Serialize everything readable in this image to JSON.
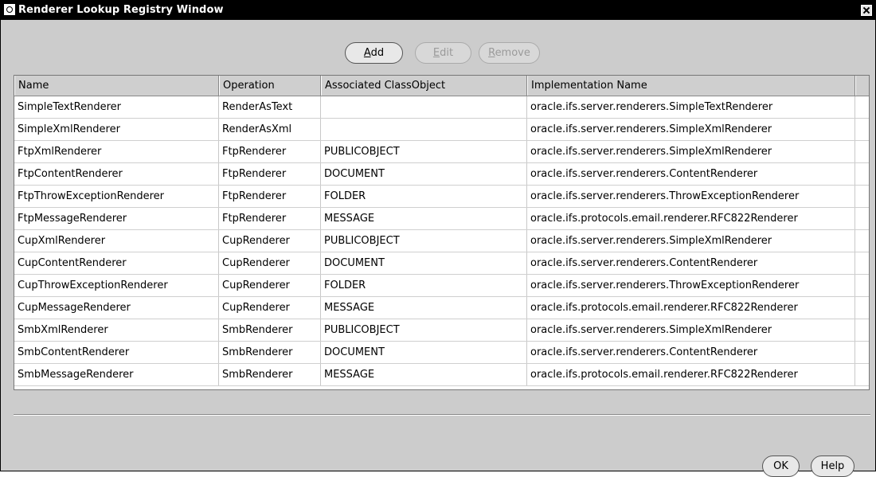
{
  "window": {
    "title": "Renderer Lookup Registry Window"
  },
  "toolbar": {
    "add": {
      "prefix": "",
      "underline": "A",
      "rest": "dd"
    },
    "edit": {
      "prefix": "",
      "underline": "E",
      "rest": "dit"
    },
    "remove": {
      "prefix": "",
      "underline": "R",
      "rest": "emove"
    }
  },
  "table": {
    "columns": [
      "Name",
      "Operation",
      "Associated ClassObject",
      "Implementation Name"
    ],
    "rows": [
      [
        "SimpleTextRenderer",
        "RenderAsText",
        "",
        "oracle.ifs.server.renderers.SimpleTextRenderer"
      ],
      [
        "SimpleXmlRenderer",
        "RenderAsXml",
        "",
        "oracle.ifs.server.renderers.SimpleXmlRenderer"
      ],
      [
        "FtpXmlRenderer",
        "FtpRenderer",
        "PUBLICOBJECT",
        "oracle.ifs.server.renderers.SimpleXmlRenderer"
      ],
      [
        "FtpContentRenderer",
        "FtpRenderer",
        "DOCUMENT",
        "oracle.ifs.server.renderers.ContentRenderer"
      ],
      [
        "FtpThrowExceptionRenderer",
        "FtpRenderer",
        "FOLDER",
        "oracle.ifs.server.renderers.ThrowExceptionRenderer"
      ],
      [
        "FtpMessageRenderer",
        "FtpRenderer",
        "MESSAGE",
        "oracle.ifs.protocols.email.renderer.RFC822Renderer"
      ],
      [
        "CupXmlRenderer",
        "CupRenderer",
        "PUBLICOBJECT",
        "oracle.ifs.server.renderers.SimpleXmlRenderer"
      ],
      [
        "CupContentRenderer",
        "CupRenderer",
        "DOCUMENT",
        "oracle.ifs.server.renderers.ContentRenderer"
      ],
      [
        "CupThrowExceptionRenderer",
        "CupRenderer",
        "FOLDER",
        "oracle.ifs.server.renderers.ThrowExceptionRenderer"
      ],
      [
        "CupMessageRenderer",
        "CupRenderer",
        "MESSAGE",
        "oracle.ifs.protocols.email.renderer.RFC822Renderer"
      ],
      [
        "SmbXmlRenderer",
        "SmbRenderer",
        "PUBLICOBJECT",
        "oracle.ifs.server.renderers.SimpleXmlRenderer"
      ],
      [
        "SmbContentRenderer",
        "SmbRenderer",
        "DOCUMENT",
        "oracle.ifs.server.renderers.ContentRenderer"
      ],
      [
        "SmbMessageRenderer",
        "SmbRenderer",
        "MESSAGE",
        "oracle.ifs.protocols.email.renderer.RFC822Renderer"
      ]
    ]
  },
  "footer": {
    "ok": "OK",
    "help": "Help"
  }
}
